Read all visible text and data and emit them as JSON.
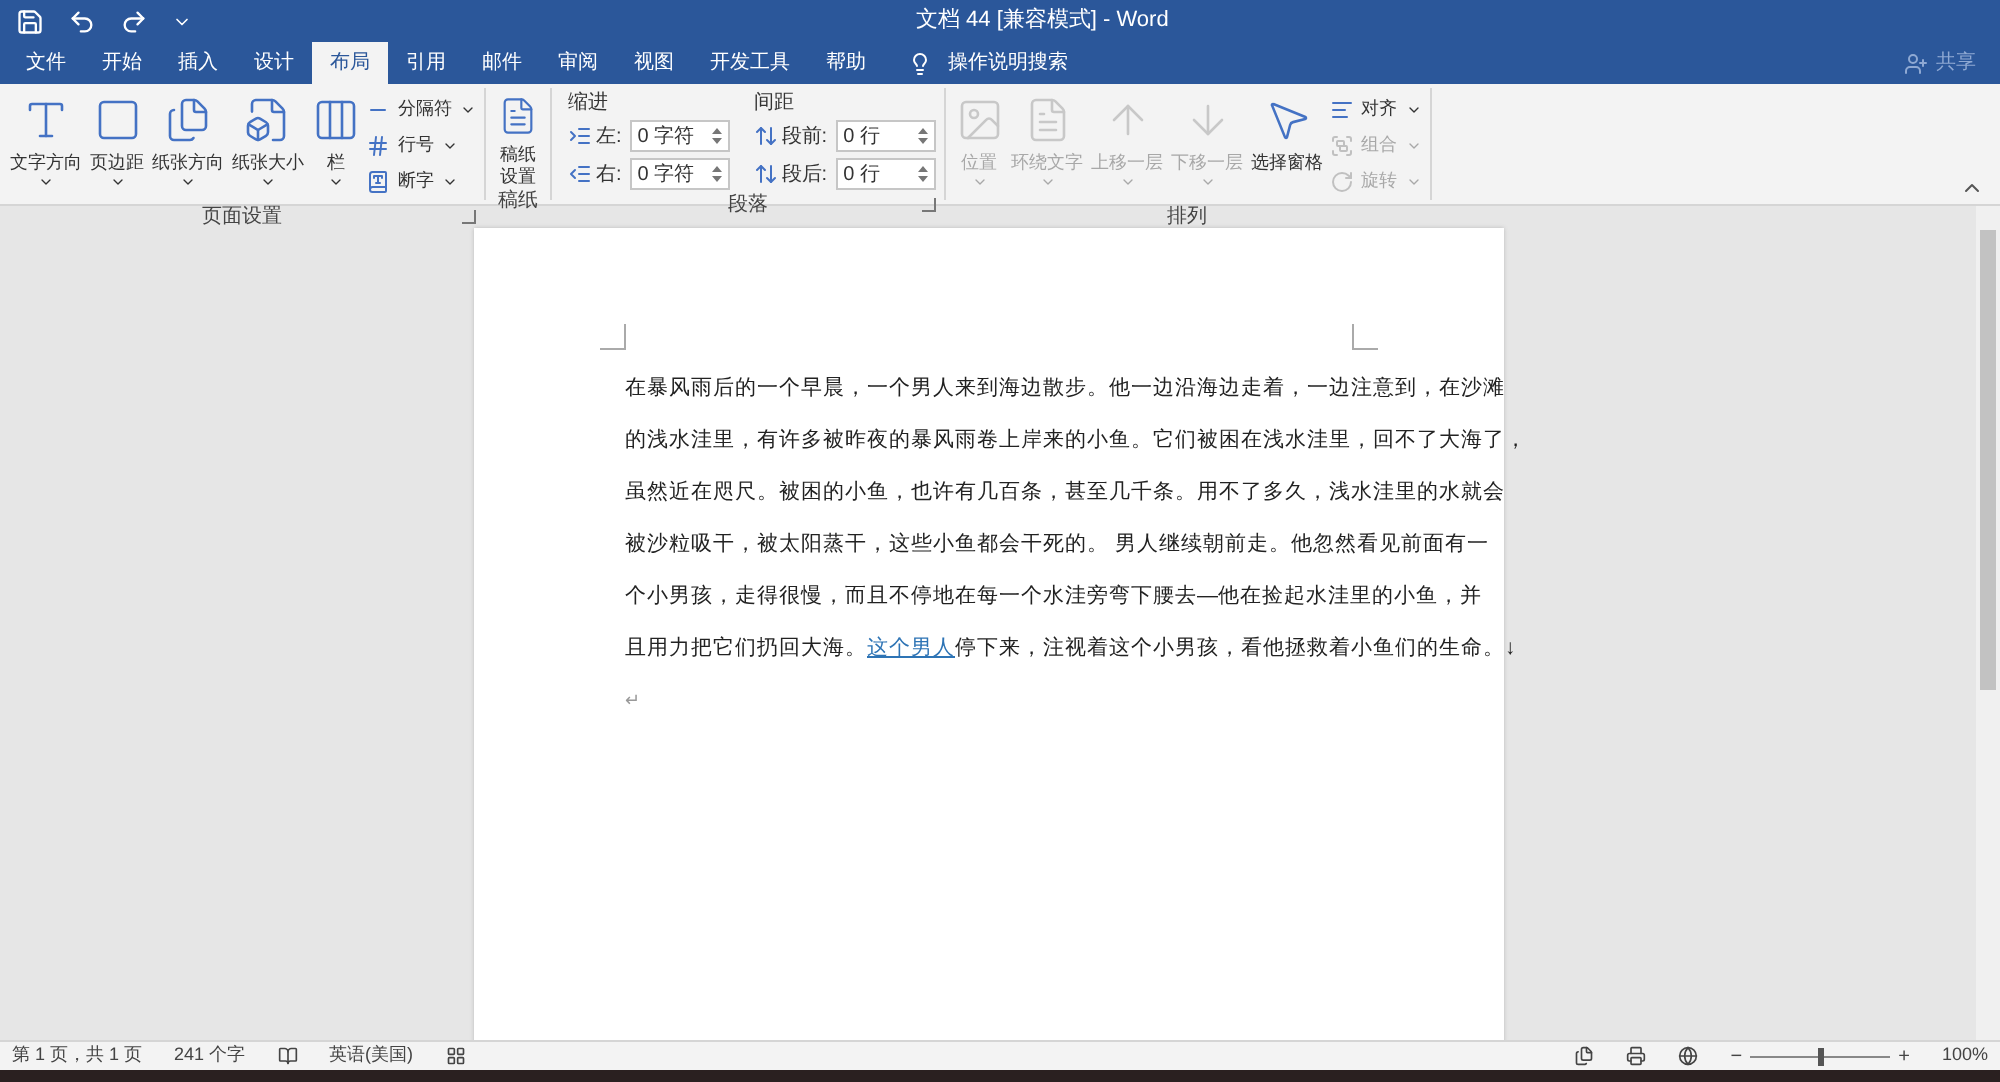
{
  "window": {
    "title": "文档 44 [兼容模式] - Word"
  },
  "tabs": [
    {
      "label": "文件",
      "selected": false
    },
    {
      "label": "开始",
      "selected": false
    },
    {
      "label": "插入",
      "selected": false
    },
    {
      "label": "设计",
      "selected": false
    },
    {
      "label": "布局",
      "selected": true
    },
    {
      "label": "引用",
      "selected": false
    },
    {
      "label": "邮件",
      "selected": false
    },
    {
      "label": "审阅",
      "selected": false
    },
    {
      "label": "视图",
      "selected": false
    },
    {
      "label": "开发工具",
      "selected": false
    },
    {
      "label": "帮助",
      "selected": false
    }
  ],
  "tell_me": {
    "placeholder": "操作说明搜索"
  },
  "share": {
    "label": "共享"
  },
  "page_setup": {
    "title": "页面设置",
    "large": [
      {
        "label": "文字方向",
        "dropdown": true
      },
      {
        "label": "页边距",
        "dropdown": true
      },
      {
        "label": "纸张方向",
        "dropdown": true
      },
      {
        "label": "纸张大小",
        "dropdown": true
      },
      {
        "label": "栏",
        "dropdown": true
      }
    ],
    "small": [
      {
        "label": "分隔符"
      },
      {
        "label": "行号"
      },
      {
        "label": "断字"
      }
    ]
  },
  "manuscript": {
    "title": "稿纸",
    "button": "稿纸设置"
  },
  "paragraph": {
    "title": "段落",
    "indent_label": "缩进",
    "spacing_label": "间距",
    "indent": [
      {
        "label": "左:",
        "value": "0 字符"
      },
      {
        "label": "右:",
        "value": "0 字符"
      }
    ],
    "spacing": [
      {
        "label": "段前:",
        "value": "0 行"
      },
      {
        "label": "段后:",
        "value": "0 行"
      }
    ]
  },
  "arrange": {
    "title": "排列",
    "large": [
      {
        "label": "位置",
        "disabled": true,
        "dropdown": true
      },
      {
        "label": "环绕文字",
        "disabled": true,
        "dropdown": true
      },
      {
        "label": "上移一层",
        "disabled": true,
        "dropdown": true
      },
      {
        "label": "下移一层",
        "disabled": true,
        "dropdown": true
      },
      {
        "label": "选择窗格",
        "disabled": false,
        "dropdown": false
      }
    ],
    "small": [
      {
        "label": "对齐",
        "disabled": false
      },
      {
        "label": "组合",
        "disabled": true
      },
      {
        "label": "旋转",
        "disabled": true
      }
    ]
  },
  "document": {
    "lines": [
      [
        {
          "kind": "text",
          "text": "在暴风雨后的一个早晨，一个男人来到海边散步。他一边沿海边走着，一边注意到，在沙滩"
        }
      ],
      [
        {
          "kind": "text",
          "text": "的浅水洼里，有许多被昨夜的暴风雨卷上岸来的小鱼。它们被困在浅水洼里，回不了大海了，"
        }
      ],
      [
        {
          "kind": "text",
          "text": "虽然近在咫尺。被困的小鱼，也许有几百条，甚至几千条。用不了多久，浅水洼里的水就会"
        }
      ],
      [
        {
          "kind": "text",
          "text": "被沙粒吸干，被太阳蒸干，这些小鱼都会干死的。 男人继续朝前走。他忽然看见前面有一"
        }
      ],
      [
        {
          "kind": "text",
          "text": "个小男孩，走得很慢，而且不停地在每一个水洼旁弯下腰去—他在捡起水洼里的小鱼，并"
        }
      ],
      [
        {
          "kind": "text",
          "text": "且用力把它们扔回大海。"
        },
        {
          "kind": "link",
          "text": "这个男人"
        },
        {
          "kind": "text",
          "text": "停下来，注视着这个小男孩，看他拯救着小鱼们的生命。↓"
        }
      ],
      [
        {
          "kind": "mark",
          "text": "↵"
        }
      ]
    ]
  },
  "status_bar": {
    "page": "第 1 页，共 1 页",
    "words": "241 个字",
    "language": "英语(美国)",
    "zoom": "100%",
    "zoom_out": "−",
    "zoom_in": "+",
    "zoom_slider": {
      "level": 0.5
    }
  }
}
